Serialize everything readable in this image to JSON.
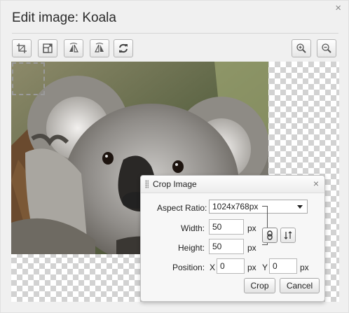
{
  "dialog": {
    "title": "Edit image: Koala",
    "close_glyph": "×"
  },
  "toolbar": {
    "left_tools": [
      "crop-icon",
      "resize-icon",
      "flip-horizontal-icon",
      "flip-vertical-icon",
      "rotate-icon"
    ],
    "right_tools": [
      "zoom-in-icon",
      "zoom-out-icon"
    ]
  },
  "canvas": {
    "image_subject": "koala"
  },
  "crop_panel": {
    "title": "Crop Image",
    "close_glyph": "×",
    "aspect_ratio_label": "Aspect Ratio:",
    "aspect_ratio_value": "1024x768px",
    "width_label": "Width:",
    "width_value": "50",
    "width_unit": "px",
    "height_label": "Height:",
    "height_value": "50",
    "height_unit": "px",
    "position_label": "Position:",
    "x_label": "X",
    "x_value": "0",
    "x_unit": "px",
    "y_label": "Y",
    "y_value": "0",
    "y_unit": "px",
    "crop_button": "Crop",
    "cancel_button": "Cancel"
  },
  "colors": {
    "checker": "#d2d2d2",
    "dialog_bg": "#f0f0f0",
    "panel_bg": "#f7f7f7"
  }
}
